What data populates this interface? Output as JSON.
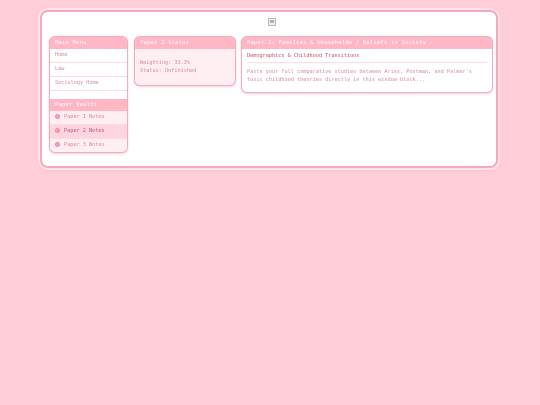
{
  "sidebar": {
    "title": "Main Menu",
    "items": [
      {
        "label": "Home"
      },
      {
        "label": "Law"
      },
      {
        "label": "Sociology Home"
      }
    ],
    "vaults_title": "Paper Vaults",
    "vaults": [
      {
        "label": "Paper 1 Notes",
        "active": false
      },
      {
        "label": "Paper 2 Notes",
        "active": true
      },
      {
        "label": "Paper 3 Notes",
        "active": false
      }
    ]
  },
  "status": {
    "title": "Paper 2 Status",
    "weighting": "Weighting: 33.3%",
    "state": "Status: Unfinished"
  },
  "paper": {
    "title": "Paper 2: Families & Households / Beliefs in Society",
    "topic": "Demographics & Childhood Transitions",
    "body": "Paste your full comparative studies between Aries, Postman, and Palmer's toxic childhood theories directly in this window block..."
  },
  "colors": {
    "background": "#ffcdd8",
    "panel_header": "#ffb6c5",
    "accent_text": "#c0506c",
    "muted_text": "#d98a9c"
  },
  "icons": {
    "banner": "broken-image-icon",
    "vault_bullet": "pink-dot-icon"
  }
}
